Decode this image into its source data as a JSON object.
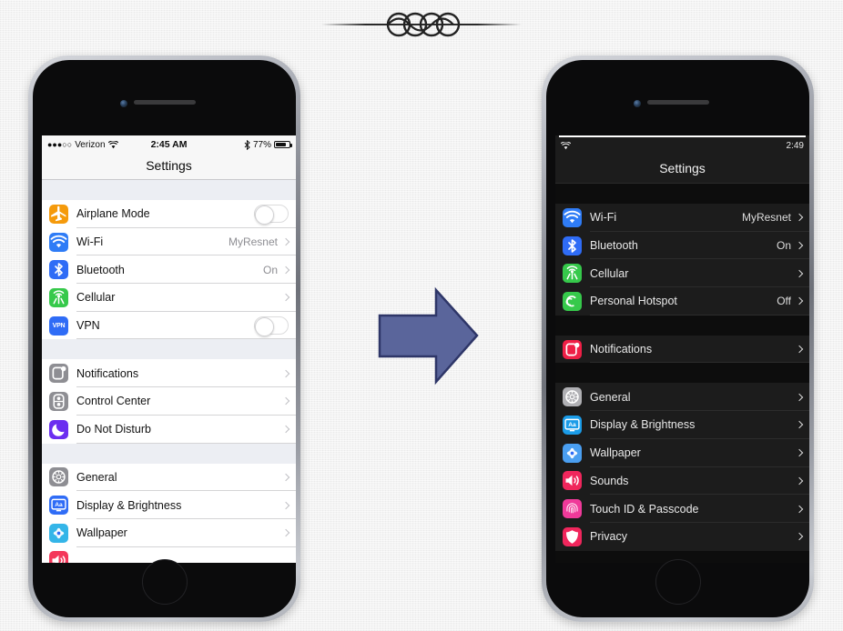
{
  "page": {
    "background_color": "#efefef",
    "ornament": "decorative-rule-ornament",
    "arrow_color": "#5a659b",
    "arrow_label": "right-arrow"
  },
  "phone_left": {
    "name": "iphone-light-settings",
    "status_bar": {
      "signal_dots": "●●●○○",
      "carrier": "Verizon",
      "wifi_icon": "wifi-icon",
      "time": "2:45 AM",
      "bluetooth_icon": "bluetooth-icon",
      "battery_percent": "77%",
      "battery_level": 77
    },
    "nav_title": "Settings",
    "groups": [
      {
        "rows": [
          {
            "icon": "airplane-icon",
            "icon_color": "#f59a0b",
            "label": "Airplane Mode",
            "control": "toggle",
            "value": "",
            "toggle_on": false
          },
          {
            "icon": "wifi-icon",
            "icon_color": "#2f7cf6",
            "label": "Wi-Fi",
            "control": "chevron",
            "value": "MyResnet"
          },
          {
            "icon": "bluetooth-icon",
            "icon_color": "#2f6cf6",
            "label": "Bluetooth",
            "control": "chevron",
            "value": "On"
          },
          {
            "icon": "cellular-icon",
            "icon_color": "#36c94b",
            "label": "Cellular",
            "control": "chevron",
            "value": ""
          },
          {
            "icon": "vpn-icon",
            "icon_color": "#2f6cf6",
            "label": "VPN",
            "control": "toggle",
            "value": "",
            "toggle_on": false
          }
        ]
      },
      {
        "rows": [
          {
            "icon": "notifications-icon",
            "icon_color": "#8e8e93",
            "label": "Notifications",
            "control": "chevron",
            "value": ""
          },
          {
            "icon": "control-center-icon",
            "icon_color": "#8e8e93",
            "label": "Control Center",
            "control": "chevron",
            "value": ""
          },
          {
            "icon": "do-not-disturb-icon",
            "icon_color": "#6b2ef0",
            "label": "Do Not Disturb",
            "control": "chevron",
            "value": ""
          }
        ]
      },
      {
        "rows": [
          {
            "icon": "general-gear-icon",
            "icon_color": "#8e8e93",
            "label": "General",
            "control": "chevron",
            "value": ""
          },
          {
            "icon": "display-brightness-icon",
            "icon_color": "#2f6cf6",
            "label": "Display & Brightness",
            "control": "chevron",
            "value": ""
          },
          {
            "icon": "wallpaper-icon",
            "icon_color": "#34b5e8",
            "label": "Wallpaper",
            "control": "chevron",
            "value": ""
          },
          {
            "icon": "sounds-icon",
            "icon_color": "#f4375a",
            "label": "",
            "control": "none",
            "value": ""
          }
        ]
      }
    ]
  },
  "phone_right": {
    "name": "iphone-dark-settings",
    "status_bar": {
      "wifi_icon": "wifi-icon",
      "time": "2:49"
    },
    "nav_title": "Settings",
    "groups": [
      {
        "rows": [
          {
            "icon": "wifi-icon",
            "icon_color": "#2f7cf6",
            "label": "Wi-Fi",
            "control": "chevron",
            "value": "MyResnet"
          },
          {
            "icon": "bluetooth-icon",
            "icon_color": "#2f6cf6",
            "label": "Bluetooth",
            "control": "chevron",
            "value": "On"
          },
          {
            "icon": "cellular-icon",
            "icon_color": "#36c94b",
            "label": "Cellular",
            "control": "chevron",
            "value": ""
          },
          {
            "icon": "personal-hotspot-icon",
            "icon_color": "#36c94b",
            "label": "Personal Hotspot",
            "control": "chevron",
            "value": "Off"
          }
        ]
      },
      {
        "rows": [
          {
            "icon": "notifications-icon",
            "icon_color": "#ef1f46",
            "label": "Notifications",
            "control": "chevron",
            "value": ""
          }
        ]
      },
      {
        "rows": [
          {
            "icon": "general-gear-icon",
            "icon_color": "#b0b0b4",
            "label": "General",
            "control": "chevron",
            "value": ""
          },
          {
            "icon": "display-brightness-icon",
            "icon_color": "#1b9ce8",
            "label": "Display & Brightness",
            "control": "chevron",
            "value": ""
          },
          {
            "icon": "wallpaper-icon",
            "icon_color": "#4a9ef0",
            "label": "Wallpaper",
            "control": "chevron",
            "value": ""
          },
          {
            "icon": "sounds-icon",
            "icon_color": "#f0265c",
            "label": "Sounds",
            "control": "chevron",
            "value": ""
          },
          {
            "icon": "touch-id-icon",
            "icon_color": "#f03a9a",
            "label": "Touch ID & Passcode",
            "control": "chevron",
            "value": ""
          },
          {
            "icon": "privacy-icon",
            "icon_color": "#f0265c",
            "label": "Privacy",
            "control": "chevron",
            "value": ""
          }
        ]
      }
    ]
  }
}
